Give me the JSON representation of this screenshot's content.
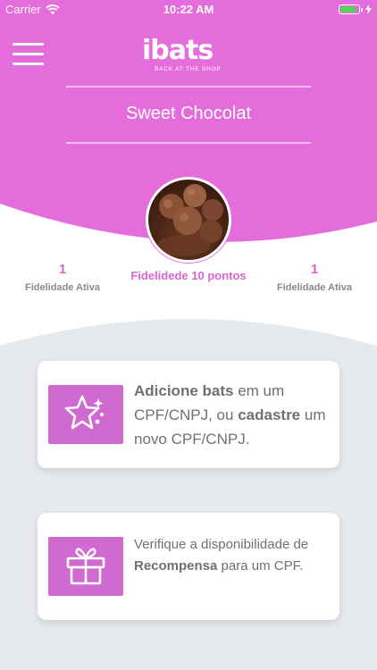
{
  "status_bar": {
    "carrier": "Carrier",
    "time": "10:22 AM",
    "battery_level": 0.85
  },
  "header": {
    "logo_text": "ibats",
    "logo_tagline": "BACK AT THE SHOP",
    "store_name": "Sweet Chocolat"
  },
  "stats": {
    "left": {
      "value": "1",
      "label": "Fidelidade Ativa"
    },
    "center": {
      "label": "Fidelidede 10 pontos"
    },
    "right": {
      "value": "1",
      "label": "Fidelidade Ativa"
    }
  },
  "cards": {
    "add": {
      "bold1": "Adicione bats",
      "text1": " em um CPF/CNPJ, ou ",
      "bold2": "cadastre",
      "text2": " um novo CPF/CNPJ."
    },
    "reward": {
      "text1": "Verifique a disponibilidade de ",
      "bold1": "Recompensa",
      "text2": " para um CPF."
    }
  },
  "colors": {
    "header": "#e56cdb",
    "accent": "#d964d0",
    "icon_bg": "#d16ad0",
    "content_bg": "#e6e9ee"
  },
  "icons": {
    "menu": "hamburger-icon",
    "wifi": "wifi-icon",
    "battery": "battery-icon",
    "star": "star-sparkle-icon",
    "gift": "gift-icon"
  }
}
